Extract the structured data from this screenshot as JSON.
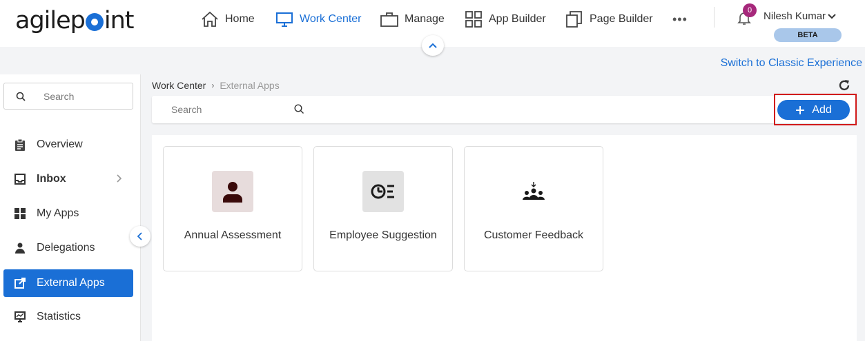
{
  "header": {
    "logo_text": "agilepoint",
    "nav": [
      {
        "label": "Home",
        "icon": "home-icon"
      },
      {
        "label": "Work Center",
        "icon": "monitor-icon",
        "active": true
      },
      {
        "label": "Manage",
        "icon": "briefcase-icon"
      },
      {
        "label": "App Builder",
        "icon": "grid-icon"
      },
      {
        "label": "Page Builder",
        "icon": "pages-icon"
      }
    ],
    "more_label": "•••",
    "notification_count": "0",
    "user_name": "Nilesh Kumar",
    "beta_label": "BETA"
  },
  "classic_link": "Switch to Classic Experience",
  "sidebar": {
    "search_placeholder": "Search",
    "items": [
      {
        "label": "Overview",
        "icon": "clipboard-icon"
      },
      {
        "label": "Inbox",
        "icon": "inbox-icon"
      },
      {
        "label": "My Apps",
        "icon": "apps-icon"
      },
      {
        "label": "Delegations",
        "icon": "person-icon"
      },
      {
        "label": "External Apps",
        "icon": "external-link-icon",
        "active": true
      },
      {
        "label": "Statistics",
        "icon": "chart-icon"
      }
    ]
  },
  "breadcrumb": {
    "root": "Work Center",
    "sep": "›",
    "current": "External Apps"
  },
  "main": {
    "search_placeholder": "Search",
    "add_label": "Add"
  },
  "apps": [
    {
      "name": "Annual Assessment",
      "icon": "person-icon",
      "bg": "#e7dcdc",
      "fg": "#3a0a0a"
    },
    {
      "name": "Employee Suggestion",
      "icon": "pie-list-icon",
      "bg": "#e2e2e2",
      "fg": "#1a1a1a"
    },
    {
      "name": "Customer Feedback",
      "icon": "group-icon",
      "bg": "#ffffff",
      "fg": "#1a1a1a"
    }
  ],
  "colors": {
    "accent": "#1a6fd6",
    "highlight_outline": "#d11a1a",
    "badge": "#a6287b"
  }
}
